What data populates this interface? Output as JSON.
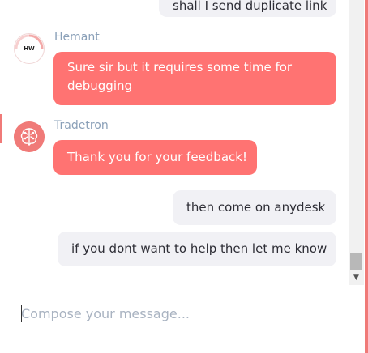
{
  "messages": [
    {
      "direction": "out",
      "text": "shall I send duplicate link"
    },
    {
      "direction": "in",
      "sender": "Hemant",
      "avatar_text": "HW",
      "text_line1": "Sure sir but it requires some time for",
      "text_line2": "debugging"
    },
    {
      "direction": "in",
      "sender": "Tradetron",
      "avatar_icon": "brain-icon",
      "text": "Thank you for your feedback!"
    },
    {
      "direction": "out",
      "text": "then come on anydesk"
    },
    {
      "direction": "out",
      "text": "if you dont want to help then let me know"
    }
  ],
  "composer": {
    "placeholder": "Compose your message...",
    "value": ""
  },
  "colors": {
    "incoming_bubble": "#ff7372",
    "outgoing_bubble": "#f1f1f5",
    "sender_name": "#8aa0b8",
    "accent": "#f07a78"
  }
}
